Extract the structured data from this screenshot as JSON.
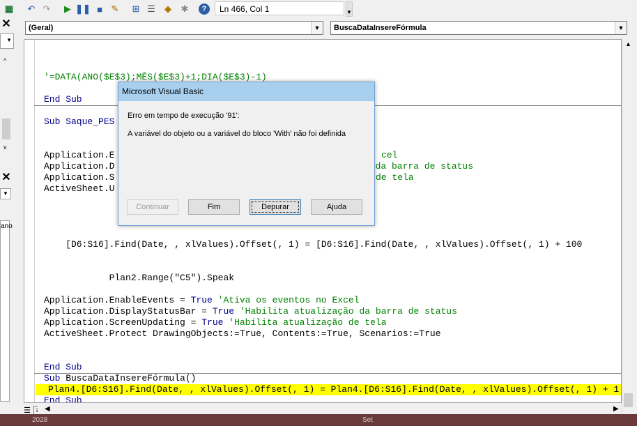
{
  "toolbar": {
    "icons": [
      "undo-icon",
      "redo-icon",
      "run-icon",
      "pause-icon",
      "stop-icon",
      "design-mode-icon",
      "project-explorer-icon",
      "properties-icon",
      "object-browser-icon",
      "toolbox-icon",
      "help-icon"
    ],
    "position": "Ln 466, Col 1"
  },
  "code_window": {
    "object_combo": "(Geral)",
    "procedure_combo": "BuscaDataInsereFórmula"
  },
  "code": {
    "formula_comment": "'=DATA(ANO($E$3);MÊS($E$3)+1;DIA($E$3)-1)",
    "end_sub": "End Sub",
    "sub_partial": "Sub Saque_PES",
    "app_e_partial": "Application.E",
    "app_e_tail": "cel",
    "app_d_partial": "Application.D",
    "app_d_tail": "o da barra de status",
    "app_s_partial": "Application.S",
    "app_s_tail": "de tela",
    "active_partial": "ActiveSheet.U",
    "find_line": "    [D6:S16].Find(Date, , xlValues).Offset(, 1) = [D6:S16].Find(Date, , xlValues).Offset(, 1) + 100",
    "speak_line": "            Plan2.Range(\"C5\").Speak",
    "enable_events": "Application.EnableEvents = ",
    "kw_true": "True",
    "enable_events_comment": " 'Ativa os eventos no Excel",
    "display_status": "Application.DisplayStatusBar = ",
    "display_status_comment": " 'Habilita atualização da barra de status",
    "screen_updating": "Application.ScreenUpdating = ",
    "screen_updating_comment": " 'Habilita atualização de tela",
    "protect_line": "ActiveSheet.Protect DrawingObjects:=True, Contents:=True, Scenarios:=True",
    "end_sub_2": "End Sub",
    "kw_sub": "Sub",
    "sub_busca_name": " BuscaDataInsereFórmula()",
    "highlighted_line": "Plan4.[D6:S16].Find(Date, , xlValues).Offset(, 1) = Plan4.[D6:S16].Find(Date, , xlValues).Offset(, 1) + 1",
    "end_sub_3": "End Sub"
  },
  "left_panel": {
    "partial_text": "ano"
  },
  "bottom_strip": {
    "left_text": "2028",
    "right_text": "Set"
  },
  "dialog": {
    "title": "Microsoft Visual Basic",
    "error_line": "Erro em tempo de execução '91':",
    "message": "A variável do objeto ou a variável do bloco 'With' não foi definida",
    "buttons": {
      "continue": "Continuar",
      "end": "Fim",
      "debug": "Depurar",
      "help": "Ajuda"
    }
  },
  "colors": {
    "keyword": "#00008b",
    "comment": "#008000",
    "highlight": "#ffff00",
    "dialog_title": "#a8cfee"
  }
}
